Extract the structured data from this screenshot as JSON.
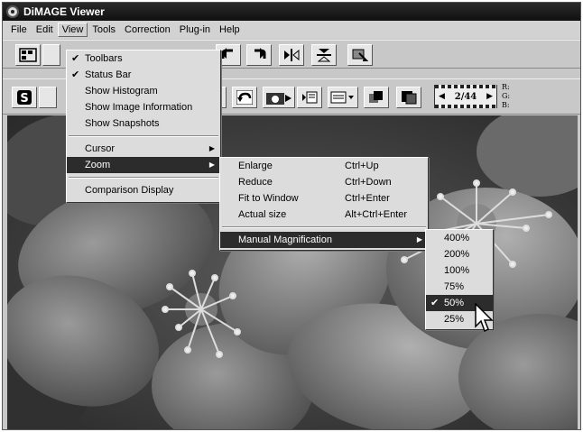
{
  "window": {
    "title": "DiMAGE Viewer"
  },
  "menubar": {
    "items": [
      "File",
      "Edit",
      "View",
      "Tools",
      "Correction",
      "Plug-in",
      "Help"
    ]
  },
  "toolbar2": {
    "counter": "2/44",
    "rgb": [
      "R:",
      "G:",
      "B:"
    ]
  },
  "view_menu": {
    "toolbars": "Toolbars",
    "status_bar": "Status Bar",
    "show_histogram": "Show Histogram",
    "show_image_information": "Show Image Information",
    "show_snapshots": "Show Snapshots",
    "cursor": "Cursor",
    "zoom": "Zoom",
    "comparison_display": "Comparison Display"
  },
  "zoom_menu": {
    "enlarge": "Enlarge",
    "enlarge_sc": "Ctrl+Up",
    "reduce": "Reduce",
    "reduce_sc": "Ctrl+Down",
    "fit": "Fit to Window",
    "fit_sc": "Ctrl+Enter",
    "actual": "Actual size",
    "actual_sc": "Alt+Ctrl+Enter",
    "manual": "Manual Magnification"
  },
  "mag_menu": {
    "items": [
      "400%",
      "200%",
      "100%",
      "75%",
      "50%",
      "25%"
    ],
    "selected": "50%"
  },
  "colors": {
    "highlight": "#2c2c2c",
    "menu_bg": "#dcdcdc"
  },
  "icons": {
    "check": "✔",
    "submenu_arrow": "▶"
  }
}
